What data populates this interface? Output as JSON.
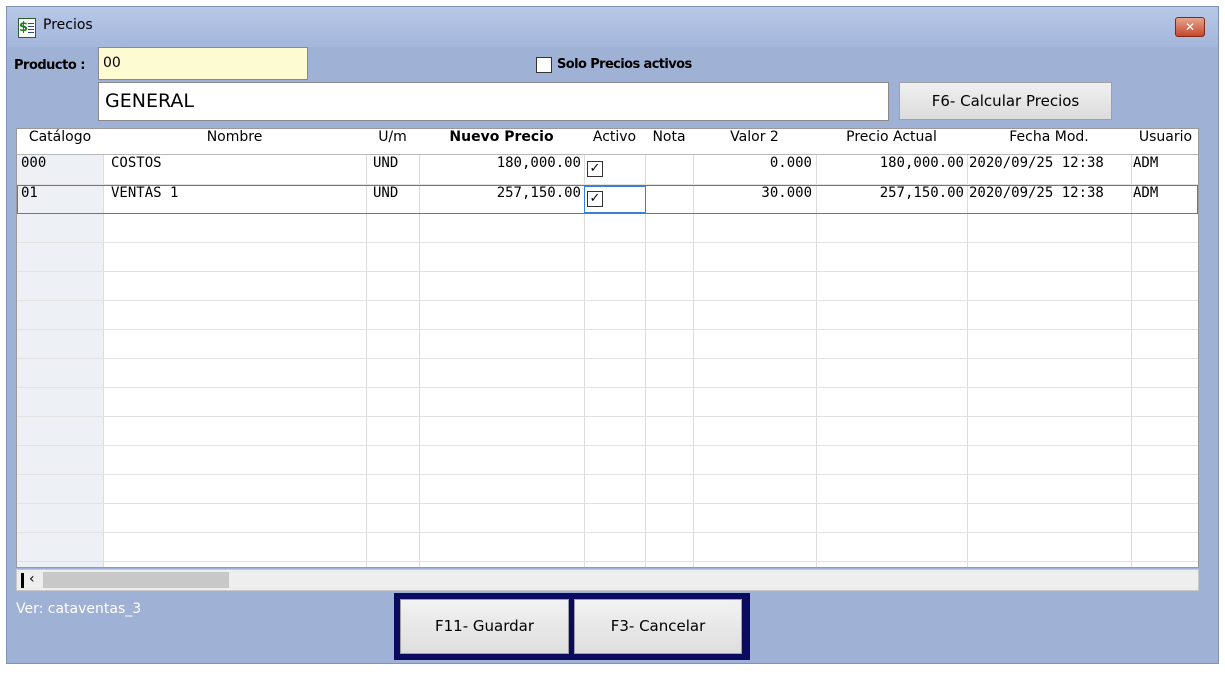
{
  "window": {
    "title": "Precios",
    "close_glyph": "✕",
    "icon": "price-sheet-icon"
  },
  "form": {
    "producto_label": "Producto :",
    "producto_value": "00",
    "solo_activos_label": "Solo Precios activos",
    "solo_activos_checked": false,
    "descripcion_value": "GENERAL",
    "calcular_label": "F6- Calcular Precios"
  },
  "grid": {
    "columns": [
      "Catálogo",
      "Nombre",
      "U/m",
      "Nuevo Precio",
      "Activo",
      "Nota",
      "Valor 2",
      "Precio Actual",
      "Fecha Mod.",
      "Usuario"
    ],
    "rows": [
      {
        "catalogo": "000",
        "nombre": "COSTOS",
        "um": "UND",
        "nuevo_precio": "180,000.00",
        "activo": true,
        "nota": "",
        "valor2": "0.000",
        "precio_actual": "180,000.00",
        "fecha_mod": "2020/09/25 12:38",
        "usuario": "ADM"
      },
      {
        "catalogo": "01",
        "nombre": "VENTAS 1",
        "um": "UND",
        "nuevo_precio": "257,150.00",
        "activo": true,
        "nota": "",
        "valor2": "30.000",
        "precio_actual": "257,150.00",
        "fecha_mod": "2020/09/25 12:38",
        "usuario": "ADM"
      }
    ],
    "check_glyph": "✓",
    "selected_row": 1
  },
  "scrollbar": {
    "left_arrow": "‹"
  },
  "footer": {
    "version": "Ver: cataventas_3",
    "guardar_label": "F11- Guardar",
    "cancelar_label": "F3- Cancelar"
  }
}
